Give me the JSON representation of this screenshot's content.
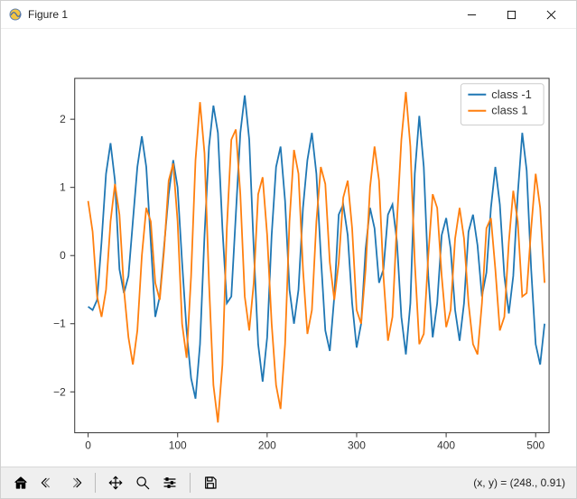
{
  "window": {
    "title": "Figure 1"
  },
  "status": {
    "coord": "(x, y) = (248., 0.91)"
  },
  "chart_data": {
    "type": "line",
    "xlabel": "",
    "ylabel": "",
    "title": "",
    "xlim": [
      -15,
      515
    ],
    "ylim": [
      -2.6,
      2.6
    ],
    "xticks": [
      0,
      100,
      200,
      300,
      400,
      500
    ],
    "yticks": [
      -2,
      -1,
      0,
      1,
      2
    ],
    "legend": {
      "position": "upper right",
      "entries": [
        "class -1",
        "class 1"
      ]
    },
    "x": [
      0,
      5,
      10,
      15,
      20,
      25,
      30,
      35,
      40,
      45,
      50,
      55,
      60,
      65,
      70,
      75,
      80,
      85,
      90,
      95,
      100,
      105,
      110,
      115,
      120,
      125,
      130,
      135,
      140,
      145,
      150,
      155,
      160,
      165,
      170,
      175,
      180,
      185,
      190,
      195,
      200,
      205,
      210,
      215,
      220,
      225,
      230,
      235,
      240,
      245,
      250,
      255,
      260,
      265,
      270,
      275,
      280,
      285,
      290,
      295,
      300,
      305,
      310,
      315,
      320,
      325,
      330,
      335,
      340,
      345,
      350,
      355,
      360,
      365,
      370,
      375,
      380,
      385,
      390,
      395,
      400,
      405,
      410,
      415,
      420,
      425,
      430,
      435,
      440,
      445,
      450,
      455,
      460,
      465,
      470,
      475,
      480,
      485,
      490,
      495,
      500,
      505,
      510
    ],
    "series": [
      {
        "name": "class -1",
        "color": "#1f77b4",
        "values": [
          -0.75,
          -0.8,
          -0.65,
          0.2,
          1.2,
          1.65,
          1.1,
          -0.2,
          -0.55,
          -0.3,
          0.5,
          1.3,
          1.75,
          1.3,
          0.2,
          -0.9,
          -0.6,
          0.15,
          0.9,
          1.4,
          1.0,
          -0.1,
          -1.1,
          -1.8,
          -2.1,
          -1.3,
          0.3,
          1.6,
          2.2,
          1.8,
          0.4,
          -0.7,
          -0.6,
          0.6,
          1.8,
          2.35,
          1.7,
          0.1,
          -1.3,
          -1.85,
          -1.2,
          0.3,
          1.3,
          1.6,
          0.8,
          -0.5,
          -1.0,
          -0.5,
          0.7,
          1.4,
          1.8,
          1.2,
          0.0,
          -1.1,
          -1.4,
          -0.6,
          0.6,
          0.75,
          0.3,
          -0.7,
          -1.35,
          -1.0,
          0.1,
          0.7,
          0.4,
          -0.4,
          -0.2,
          0.6,
          0.75,
          0.2,
          -0.9,
          -1.45,
          -0.7,
          1.2,
          2.05,
          1.3,
          -0.3,
          -1.2,
          -0.7,
          0.3,
          0.55,
          0.1,
          -0.8,
          -1.25,
          -0.7,
          0.35,
          0.6,
          0.15,
          -0.6,
          -0.25,
          0.7,
          1.3,
          0.75,
          -0.3,
          -0.85,
          -0.3,
          0.9,
          1.8,
          1.25,
          -0.2,
          -1.3,
          -1.6,
          -1.0
        ]
      },
      {
        "name": "class 1",
        "color": "#ff7f0e",
        "values": [
          0.8,
          0.35,
          -0.6,
          -0.9,
          -0.5,
          0.5,
          1.05,
          0.6,
          -0.5,
          -1.2,
          -1.6,
          -1.1,
          0.0,
          0.7,
          0.5,
          -0.4,
          -0.65,
          0.1,
          1.1,
          1.35,
          0.5,
          -1.0,
          -1.5,
          -0.3,
          1.4,
          2.25,
          1.5,
          -0.4,
          -1.9,
          -2.45,
          -1.6,
          0.4,
          1.7,
          1.85,
          0.9,
          -0.6,
          -1.1,
          -0.4,
          0.9,
          1.15,
          0.3,
          -1.0,
          -1.9,
          -2.25,
          -1.3,
          0.5,
          1.55,
          1.2,
          -0.2,
          -1.15,
          -0.8,
          0.5,
          1.3,
          1.05,
          -0.1,
          -0.65,
          -0.1,
          0.85,
          1.1,
          0.4,
          -0.8,
          -1.0,
          -0.2,
          1.0,
          1.6,
          1.1,
          -0.3,
          -1.25,
          -0.9,
          0.5,
          1.7,
          2.4,
          1.6,
          -0.1,
          -1.3,
          -1.15,
          0.0,
          0.9,
          0.7,
          -0.3,
          -1.05,
          -0.8,
          0.25,
          0.7,
          0.25,
          -0.7,
          -1.3,
          -1.45,
          -0.7,
          0.4,
          0.55,
          -0.2,
          -1.1,
          -0.9,
          0.2,
          0.95,
          0.5,
          -0.6,
          -0.55,
          0.4,
          1.2,
          0.7,
          -0.4
        ]
      }
    ]
  }
}
